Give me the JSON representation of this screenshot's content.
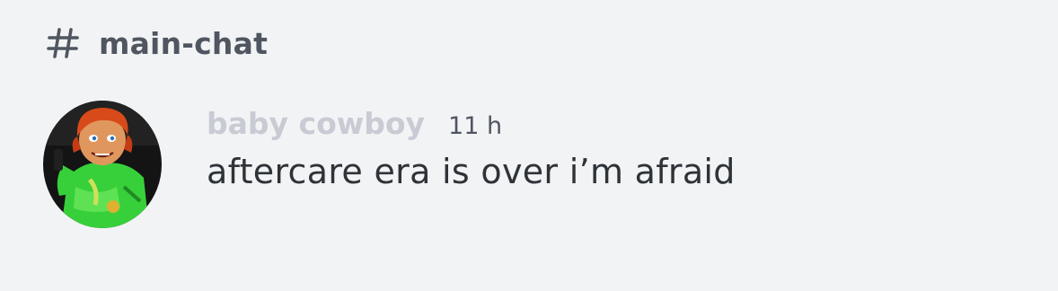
{
  "channel": {
    "name": "main-chat",
    "icon": "hash-icon"
  },
  "message": {
    "author": "baby cowboy",
    "timestamp": "11 h",
    "content": "aftercare era is over i’m afraid",
    "avatar_icon": "user-avatar"
  },
  "colors": {
    "background": "#f2f3f5",
    "author_name": "#c8cbd3",
    "channel_name": "#4f5660",
    "message_text": "#2e3338",
    "avatar_accent": "#38d03a"
  }
}
